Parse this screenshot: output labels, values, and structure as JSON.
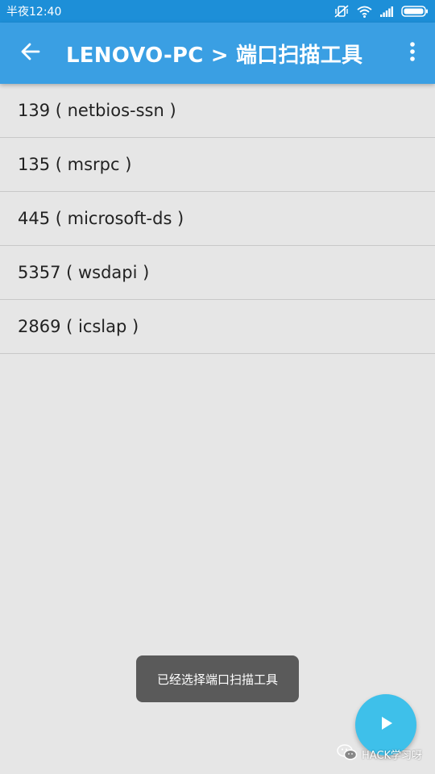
{
  "status_bar": {
    "time": "半夜12:40"
  },
  "app_bar": {
    "title": "LENOVO-PC > 端口扫描工具"
  },
  "ports": [
    {
      "label": "139 ( netbios-ssn )"
    },
    {
      "label": "135 ( msrpc )"
    },
    {
      "label": "445 ( microsoft-ds )"
    },
    {
      "label": "5357 ( wsdapi )"
    },
    {
      "label": "2869 ( icslap )"
    }
  ],
  "toast": {
    "message": "已经选择端口扫描工具"
  },
  "watermark": {
    "text": "HACK学习呀"
  },
  "icons": {
    "back": "arrow-left-icon",
    "overflow": "more-vert-icon",
    "fab": "play-icon",
    "status": [
      "vibrate-off-icon",
      "wifi-icon",
      "signal-icon",
      "battery-icon"
    ]
  },
  "colors": {
    "status_bar": "#1d8fd8",
    "app_bar": "#3a9fe3",
    "background": "#e6e6e6",
    "fab": "#3ec0ea",
    "toast": "#5a5a5a"
  }
}
